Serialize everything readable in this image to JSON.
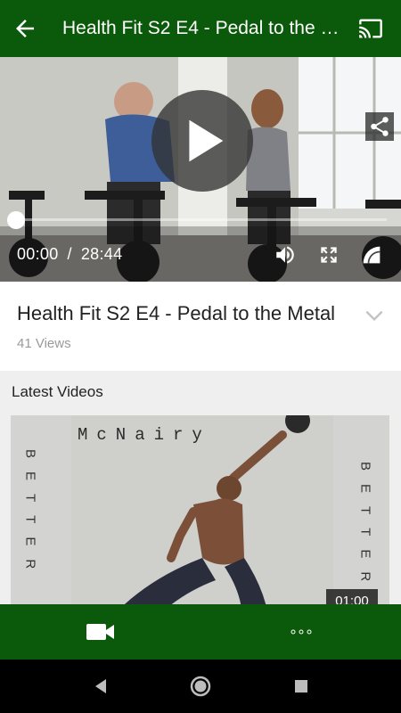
{
  "app_bar": {
    "title": "Health Fit S2 E4 - Pedal to the Metal",
    "back_icon": "arrow-left-icon",
    "cast_icon": "cast-icon"
  },
  "player": {
    "current_time": "00:00",
    "separator": "/",
    "duration": "28:44",
    "progress": 0,
    "icons": [
      "play-icon",
      "share-icon",
      "volume-icon",
      "fullscreen-icon",
      "fit-icon"
    ]
  },
  "video_info": {
    "title": "Health Fit S2 E4 - Pedal to the Metal",
    "views": "41 Views",
    "expand_icon": "chevron-down-icon"
  },
  "latest": {
    "heading": "Latest Videos",
    "items": [
      {
        "title_text": "McNairy",
        "left_side_text": "BETTER",
        "right_side_text": "BETTER",
        "duration": "01:00"
      }
    ]
  },
  "bottom_nav": {
    "tabs": [
      {
        "icon": "video-camera-icon"
      },
      {
        "icon": "more-dots-icon"
      }
    ]
  },
  "colors": {
    "brand_green": "#0b5a0b",
    "background": "#ffffff",
    "section_gray": "#efefef"
  }
}
